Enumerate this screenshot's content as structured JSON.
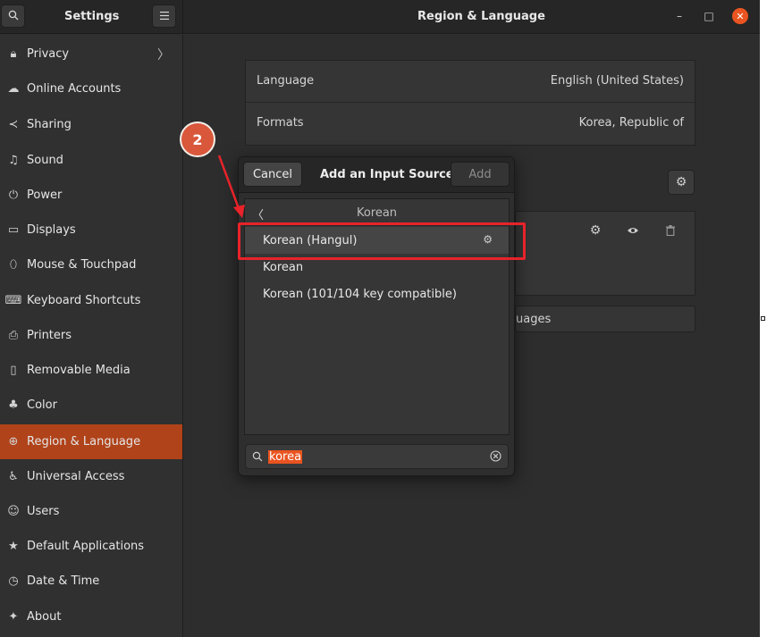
{
  "header": {
    "search_icon": "search-icon",
    "sidebar_title": "Settings",
    "menu_icon": "hamburger-icon",
    "window_title": "Region & Language",
    "minimize_glyph": "–",
    "maximize_glyph": "□",
    "close_glyph": "✕"
  },
  "sidebar": {
    "items": [
      {
        "label": "Privacy",
        "icon": "lock-icon",
        "glyph": "🔒︎",
        "chevron": "〉"
      },
      {
        "label": "Online Accounts",
        "icon": "cloud-icon",
        "glyph": "☁"
      },
      {
        "label": "Sharing",
        "icon": "share-icon",
        "glyph": "≺"
      },
      {
        "label": "Sound",
        "icon": "music-note-icon",
        "glyph": "♫"
      },
      {
        "label": "Power",
        "icon": "power-icon",
        "glyph": "⏻"
      },
      {
        "label": "Displays",
        "icon": "display-icon",
        "glyph": "▭"
      },
      {
        "label": "Mouse & Touchpad",
        "icon": "mouse-icon",
        "glyph": "⬯"
      },
      {
        "label": "Keyboard Shortcuts",
        "icon": "keyboard-icon",
        "glyph": "⌨"
      },
      {
        "label": "Printers",
        "icon": "printer-icon",
        "glyph": "⎙"
      },
      {
        "label": "Removable Media",
        "icon": "usb-drive-icon",
        "glyph": "▯"
      },
      {
        "label": "Color",
        "icon": "color-palette-icon",
        "glyph": "♣"
      },
      {
        "label": "Region & Language",
        "icon": "globe-icon",
        "glyph": "⊕"
      },
      {
        "label": "Universal Access",
        "icon": "accessibility-icon",
        "glyph": "♿︎"
      },
      {
        "label": "Users",
        "icon": "users-icon",
        "glyph": "☺"
      },
      {
        "label": "Default Applications",
        "icon": "star-icon",
        "glyph": "★"
      },
      {
        "label": "Date & Time",
        "icon": "clock-icon",
        "glyph": "◷"
      },
      {
        "label": "About",
        "icon": "about-icon",
        "glyph": "✦"
      }
    ],
    "active_index": 11
  },
  "main": {
    "language_label": "Language",
    "language_value": "English (United States)",
    "formats_label": "Formats",
    "formats_value": "Korea, Republic of",
    "input_sources_options_icon": "gear-icon",
    "input_row_icons": [
      "gear-icon",
      "eye-icon",
      "trash-icon"
    ],
    "manage_languages_partial": "uages"
  },
  "dialog": {
    "cancel_label": "Cancel",
    "title": "Add an Input Source",
    "add_label": "Add",
    "list_header_back": "〈",
    "list_header_title": "Korean",
    "items": [
      {
        "label": "Korean (Hangul)",
        "has_settings": true
      },
      {
        "label": "Korean",
        "has_settings": false
      },
      {
        "label": "Korean (101/104 key compatible)",
        "has_settings": false
      }
    ],
    "selected_index": 0,
    "search_value": "korea",
    "search_icon": "search-icon",
    "clear_icon": "clear-icon"
  },
  "annotation": {
    "step_number": "2",
    "highlight_color": "#e8232a",
    "badge_color": "#d9573b"
  },
  "colors": {
    "accent": "#e95420",
    "sidebar_active": "#b0431a"
  }
}
